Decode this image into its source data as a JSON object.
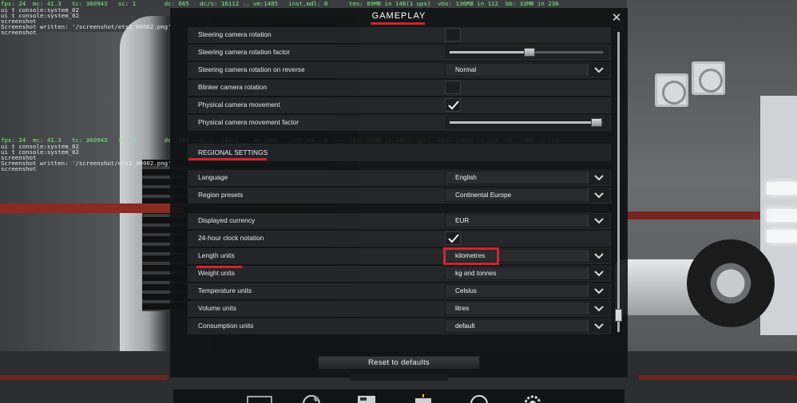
{
  "debug": {
    "line1": "fps: 24  mc: 41.3   tc: 360943   sc: 1        dc: 665   dc/s: 16112 .. vm:1485   inst.mdl: 0      tex: 89MB in 148(1 ups)  vbo: 136MB in 112  bb: 33MB in 230",
    "line2": "ui t console:system_02",
    "line3": "ui t console:system_02",
    "line4": "screenshot",
    "line5": "Screenshot written: '/screenshot/ets2_00002.png'.",
    "line6": "screenshot",
    "line7": "fps: 24  mc: 41.3   tc: 360943   sc: 1        dc: 665   dc/s: 16112 .. vm:1485   inst.mdl: 0      tex: 89MB in 148(1 ups)  vbo: 136MB in 112  bb: 33MB in 230",
    "line8": "ui t console:system_02",
    "line9": "ui t console:system_02",
    "line10": "screenshot",
    "line11": "Screenshot written: '/screenshot/ets2_00002.png'.",
    "line12": "screenshot"
  },
  "panel": {
    "title": "GAMEPLAY",
    "close_icon": "close-icon"
  },
  "camera_rows": [
    {
      "label": "Steering camera rotation",
      "control": "checkbox",
      "checked": false
    },
    {
      "label": "Steering camera rotation factor",
      "control": "slider",
      "level": 0.52
    },
    {
      "label": "Steering camera rotation on reverse",
      "control": "dropdown",
      "value": "Normal"
    },
    {
      "label": "Blinker camera rotation",
      "control": "checkbox",
      "checked": false
    },
    {
      "label": "Physical camera movement",
      "control": "checkbox",
      "checked": true
    },
    {
      "label": "Physical camera movement factor",
      "control": "slider",
      "level": 0.96
    }
  ],
  "regional": {
    "heading": "REGIONAL SETTINGS",
    "rows": [
      {
        "label": "Language",
        "control": "dropdown",
        "value": "English"
      },
      {
        "label": "Region presets",
        "control": "dropdown",
        "value": "Continental Europe"
      },
      {
        "label": "Displayed currency",
        "control": "dropdown",
        "value": "EUR"
      },
      {
        "label": "24-hour clock notation",
        "control": "checkbox",
        "checked": true
      },
      {
        "label": "Length units",
        "control": "dropdown",
        "value": "kilometres"
      },
      {
        "label": "Weight units",
        "control": "dropdown",
        "value": "kg and tonnes"
      },
      {
        "label": "Temperature units",
        "control": "dropdown",
        "value": "Celsius"
      },
      {
        "label": "Volume units",
        "control": "dropdown",
        "value": "litres"
      },
      {
        "label": "Consumption units",
        "control": "dropdown",
        "value": "default"
      }
    ]
  },
  "scrollbar": {
    "position": 0.97
  },
  "footer": {
    "reset_label": "Reset to defaults"
  },
  "colors": {
    "accent_red": "#d1252c",
    "panel_bg": "#111214"
  },
  "bottom_icons": [
    "monitor-icon",
    "steering-wheel-icon",
    "truck-icon",
    "keyboard-icon",
    "audio-icon",
    "gear-icon"
  ]
}
